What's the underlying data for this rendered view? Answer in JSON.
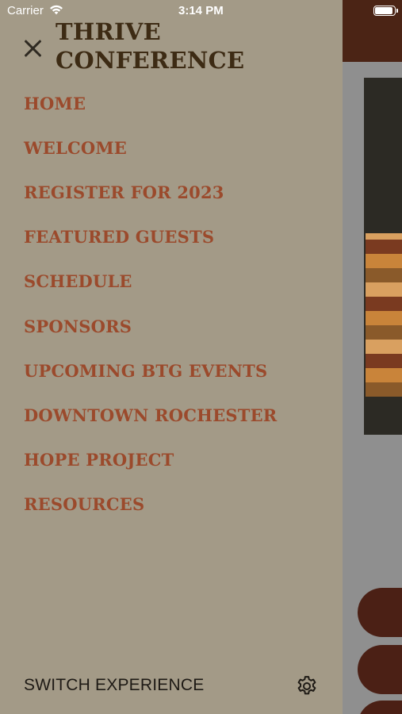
{
  "status_bar": {
    "carrier": "Carrier",
    "time": "3:14 PM",
    "wifi_icon": "wifi-icon",
    "battery_icon": "battery-icon"
  },
  "drawer": {
    "title_line1": "THRIVE",
    "title_line2": "CONFERENCE",
    "close_icon": "close-icon",
    "items": [
      {
        "label": "HOME"
      },
      {
        "label": "WELCOME"
      },
      {
        "label": "REGISTER FOR 2023"
      },
      {
        "label": "FEATURED GUESTS"
      },
      {
        "label": "SCHEDULE"
      },
      {
        "label": "SPONSORS"
      },
      {
        "label": "UPCOMING BTG EVENTS"
      },
      {
        "label": "DOWNTOWN ROCHESTER"
      },
      {
        "label": "HOPE PROJECT"
      },
      {
        "label": "RESOURCES"
      }
    ],
    "footer": {
      "switch_label": "SWITCH EXPERIENCE",
      "settings_icon": "gear-icon"
    }
  },
  "background": {
    "menu_icon": "hamburger-menu-icon"
  },
  "colors": {
    "drawer_bg": "#a39a87",
    "title": "#3d2b14",
    "nav_text": "#9b4a2c",
    "header_brand": "#4b2415"
  }
}
